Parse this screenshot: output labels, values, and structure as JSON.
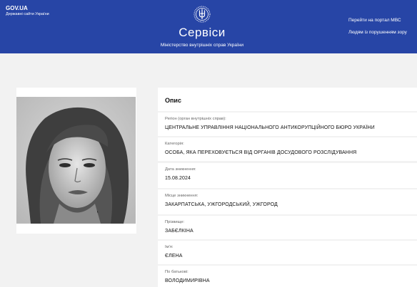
{
  "header": {
    "gov_title": "GOV.UA",
    "gov_subtitle": "Державні сайти України",
    "site_title": "Сервіси",
    "site_subtitle": "Міністерство внутрішніх справ України",
    "links": [
      "Перейти на портал МВС",
      "Людям із порушенням зору"
    ],
    "bg_color": "#2745a6"
  },
  "photo": {
    "icon": "person-photo"
  },
  "details": {
    "title": "Опис",
    "fields": [
      {
        "label": "Регіон (орган внутрішніх справ):",
        "value": "ЦЕНТРАЛЬНЕ УПРАВЛІННЯ НАЦІОНАЛЬНОГО АНТИКОРУПЦІЙНОГО БЮРО УКРАЇНИ"
      },
      {
        "label": "Категорія:",
        "value": "ОСОБА, ЯКА ПЕРЕХОВУЄТЬСЯ ВІД ОРГАНІВ ДОСУДОВОГО РОЗСЛІДУВАННЯ"
      },
      {
        "label": "Дата зникнення:",
        "value": "15.08.2024"
      },
      {
        "label": "Місце зникнення:",
        "value": "ЗАКАРПАТСЬКА, УЖГОРОДСЬКИЙ, УЖГОРОД"
      },
      {
        "label": "Прізвище:",
        "value": "ЗАБЄЛКІНА"
      },
      {
        "label": "Ім'я:",
        "value": "ЄЛЕНА"
      },
      {
        "label": "По батькові:",
        "value": "ВОЛОДИМИРІВНА"
      }
    ]
  }
}
